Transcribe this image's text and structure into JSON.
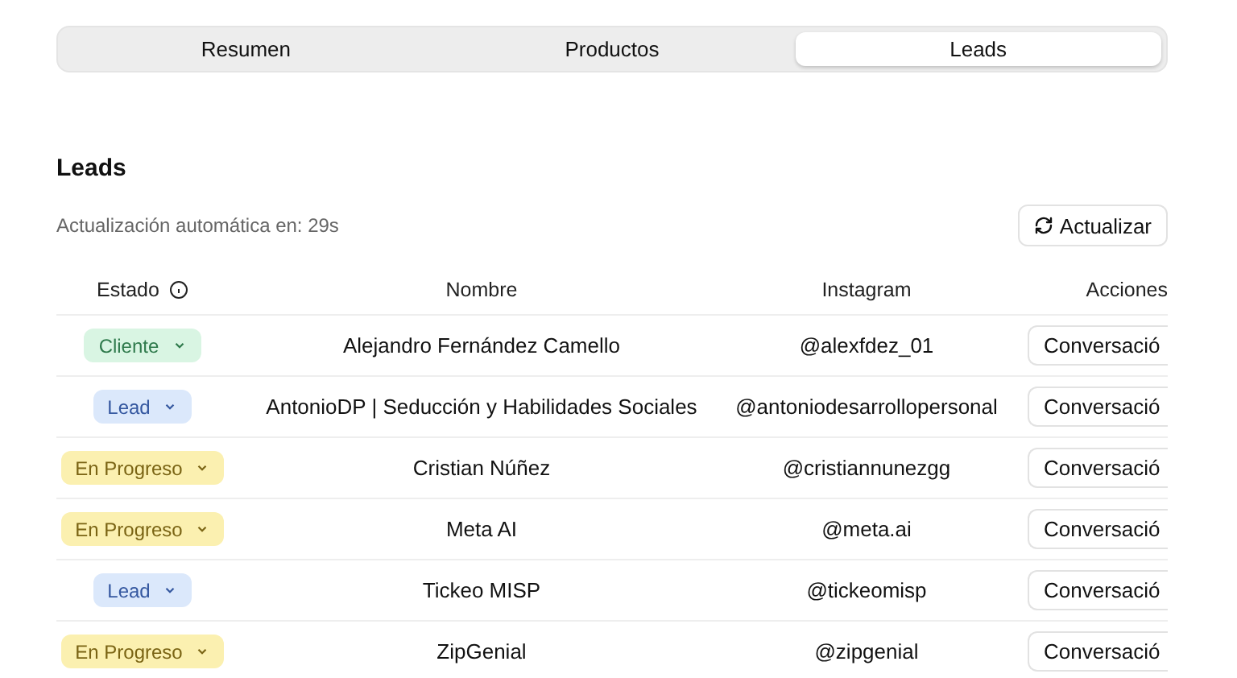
{
  "tabs": [
    {
      "label": "Resumen",
      "selected": false
    },
    {
      "label": "Productos",
      "selected": false
    },
    {
      "label": "Leads",
      "selected": true
    }
  ],
  "section_title": "Leads",
  "auto_refresh": "Actualización automática en: 29s",
  "refresh_button": "Actualizar",
  "table": {
    "columns": [
      "Estado",
      "Nombre",
      "Instagram",
      "Acciones"
    ],
    "rows": [
      {
        "status": {
          "label": "Cliente",
          "kind": "client"
        },
        "name": "Alejandro Fernández Camello",
        "instagram": "@alexfdez_01",
        "action": "Conversació"
      },
      {
        "status": {
          "label": "Lead",
          "kind": "lead"
        },
        "name": "AntonioDP | Seducción y Habilidades Sociales",
        "instagram": "@antoniodesarrollopersonal",
        "action": "Conversació"
      },
      {
        "status": {
          "label": "En Progreso",
          "kind": "progress"
        },
        "name": "Cristian Núñez",
        "instagram": "@cristiannunezgg",
        "action": "Conversació"
      },
      {
        "status": {
          "label": "En Progreso",
          "kind": "progress"
        },
        "name": "Meta AI",
        "instagram": "@meta.ai",
        "action": "Conversació"
      },
      {
        "status": {
          "label": "Lead",
          "kind": "lead"
        },
        "name": "Tickeo MISP",
        "instagram": "@tickeomisp",
        "action": "Conversació"
      },
      {
        "status": {
          "label": "En Progreso",
          "kind": "progress"
        },
        "name": "ZipGenial",
        "instagram": "@zipgenial",
        "action": "Conversació"
      }
    ]
  }
}
